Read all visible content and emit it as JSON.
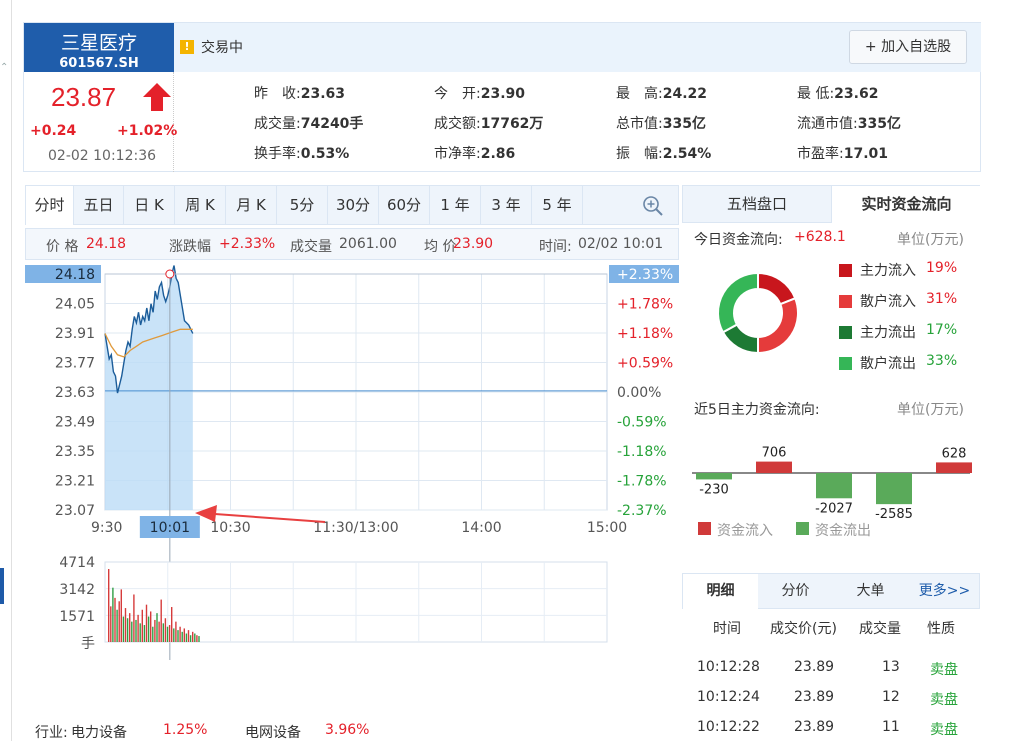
{
  "stock": {
    "name": "三星医疗",
    "code": "601567.SH",
    "price": "23.87",
    "change": "+0.24",
    "change_pct": "+1.02%",
    "datetime": "02-02 10:12:36",
    "status": "交易中",
    "add_watch_label": "加入自选股"
  },
  "quote": [
    {
      "label": "昨　收:",
      "value": "23.63",
      "color": "normal"
    },
    {
      "label": "今　开:",
      "value": "23.90",
      "color": "normal"
    },
    {
      "label": "最　高:",
      "value": "24.22",
      "color": "normal"
    },
    {
      "label": "最 低:",
      "value": "23.62",
      "color": "normal"
    },
    {
      "label": "成交量:",
      "value": "74240手",
      "color": "normal"
    },
    {
      "label": "成交额:",
      "value": "17762万",
      "color": "normal"
    },
    {
      "label": "总市值:",
      "value": "335亿",
      "color": "normal"
    },
    {
      "label": "流通市值:",
      "value": "335亿",
      "color": "normal"
    },
    {
      "label": "换手率:",
      "value": "0.53%",
      "color": "normal"
    },
    {
      "label": "市净率:",
      "value": "2.86",
      "color": "normal"
    },
    {
      "label": "振　幅:",
      "value": "2.54%",
      "color": "normal"
    },
    {
      "label": "市盈率:",
      "value": "17.01",
      "color": "normal"
    }
  ],
  "chart_tabs": [
    "分时",
    "五日",
    "日 K",
    "周 K",
    "月 K",
    "5分",
    "30分",
    "60分",
    "1 年",
    "3 年",
    "5 年"
  ],
  "info_line": {
    "price_label": "价 格",
    "price": "24.18",
    "pct_label": "涨跌幅",
    "pct": "+2.33%",
    "vol_label": "成交量",
    "vol": "2061.00",
    "avg_label": "均 价",
    "avg": "23.90",
    "time_label": "时间:",
    "time": "02/02 10:01"
  },
  "chart_data": {
    "type": "line",
    "title": "",
    "y_price_ticks": [
      "24.18",
      "24.05",
      "23.91",
      "23.77",
      "23.63",
      "23.49",
      "23.35",
      "23.21",
      "23.07"
    ],
    "y_pct_ticks": [
      "+2.33%",
      "+1.78%",
      "+1.18%",
      "+0.59%",
      "0.00%",
      "-0.59%",
      "-1.18%",
      "-1.78%",
      "-2.37%"
    ],
    "x_ticks": [
      "9:30",
      "10:30",
      "11:30/13:00",
      "14:00",
      "15:00"
    ],
    "crosshair_x_label": "10:01",
    "ylim": [
      23.07,
      24.18
    ],
    "prev_close": 23.63,
    "series": [
      {
        "name": "",
        "x_minutes": [
          0,
          1,
          2,
          3,
          4,
          5,
          6,
          7,
          8,
          9,
          10,
          11,
          12,
          13,
          14,
          15,
          16,
          17,
          18,
          19,
          20,
          21,
          22,
          23,
          24,
          25,
          26,
          27,
          28,
          29,
          30,
          31,
          32,
          33,
          34,
          35,
          36,
          37,
          38,
          39,
          40,
          41,
          42
        ],
        "values": [
          23.9,
          23.84,
          23.78,
          23.8,
          23.72,
          23.7,
          23.62,
          23.66,
          23.7,
          23.76,
          23.82,
          23.86,
          23.84,
          23.92,
          23.98,
          23.95,
          24.0,
          23.94,
          23.98,
          23.96,
          24.02,
          23.96,
          24.04,
          24.0,
          24.1,
          24.06,
          24.12,
          24.14,
          24.08,
          24.05,
          24.08,
          24.12,
          24.18,
          24.22,
          24.16,
          24.14,
          24.08,
          24.02,
          23.96,
          23.95,
          23.94,
          23.92,
          23.9
        ]
      },
      {
        "name": "",
        "x_minutes": [
          0,
          3,
          6,
          9,
          12,
          15,
          18,
          21,
          24,
          27,
          30,
          33,
          36,
          39,
          42
        ],
        "values": [
          23.9,
          23.84,
          23.8,
          23.79,
          23.82,
          23.84,
          23.86,
          23.87,
          23.88,
          23.89,
          23.9,
          23.91,
          23.92,
          23.92,
          23.92
        ]
      }
    ],
    "volume": {
      "y_ticks": [
        "4714",
        "3142",
        "1571",
        "手"
      ],
      "ylim": [
        0,
        4714
      ],
      "bars": [
        4300,
        2100,
        3200,
        2600,
        1900,
        2400,
        3100,
        1500,
        2000,
        1400,
        1700,
        1200,
        2800,
        1300,
        1600,
        1100,
        1900,
        1000,
        2200,
        1500,
        1800,
        900,
        1300,
        1700,
        1200,
        2500,
        1100,
        1400,
        900,
        1000,
        2061,
        800,
        1200,
        700,
        900,
        600,
        800,
        500,
        700,
        400,
        600,
        500,
        400,
        350
      ],
      "bar_colors": [
        "r",
        "r",
        "g",
        "r",
        "g",
        "r",
        "r",
        "g",
        "r",
        "g",
        "r",
        "g",
        "r",
        "g",
        "r",
        "g",
        "r",
        "g",
        "r",
        "g",
        "r",
        "g",
        "r",
        "g",
        "r",
        "r",
        "g",
        "r",
        "g",
        "r",
        "r",
        "g",
        "r",
        "g",
        "r",
        "g",
        "r",
        "g",
        "r",
        "g",
        "r",
        "g",
        "r",
        "g"
      ]
    }
  },
  "right_tabs": [
    "五档盘口",
    "实时资金流向"
  ],
  "flow": {
    "today_label": "今日资金流向:",
    "today_value": "+628.1",
    "unit": "单位(万元)",
    "pie": [
      {
        "label": "主力流入",
        "pct": "19%",
        "value": 19,
        "color": "#c8161d"
      },
      {
        "label": "散户流入",
        "pct": "31%",
        "value": 31,
        "color": "#e53b3b"
      },
      {
        "label": "主力流出",
        "pct": "17%",
        "value": 17,
        "color": "#1d7a34"
      },
      {
        "label": "散户流出",
        "pct": "33%",
        "value": 33,
        "color": "#35b657"
      }
    ],
    "five_day_label": "近5日主力资金流向:",
    "five_day_unit": "单位(万元)",
    "five_day": [
      -230,
      706,
      -2027,
      -2585,
      628
    ],
    "five_day_labels": [
      "-230",
      "706",
      "-2027",
      "-2585",
      "628"
    ],
    "legend_in": "资金流入",
    "legend_out": "资金流出",
    "color_in": "#d03a3a",
    "color_out": "#5aaa5a"
  },
  "detail": {
    "tabs": [
      "明细",
      "分价",
      "大单",
      "更多>>"
    ],
    "headers": [
      "时间",
      "成交价(元)",
      "成交量",
      "性质"
    ],
    "rows": [
      {
        "time": "10:12:28",
        "price": "23.89",
        "vol": "13",
        "type": "卖盘"
      },
      {
        "time": "10:12:24",
        "price": "23.89",
        "vol": "12",
        "type": "卖盘"
      },
      {
        "time": "10:12:22",
        "price": "23.89",
        "vol": "11",
        "type": "卖盘"
      }
    ]
  },
  "footer": {
    "industry_label": "行业:",
    "industry": "电力设备",
    "industry_pct": "1.25%",
    "concept": "电网设备",
    "concept_pct": "3.96%"
  },
  "colors": {
    "accent_blue": "#1f5dab",
    "up_red": "#e4212a",
    "down_green": "#27a33a",
    "line_blue": "#1c5d9a",
    "avg_orange": "#e09a3c",
    "fill_blue": "#bcdcf6"
  }
}
